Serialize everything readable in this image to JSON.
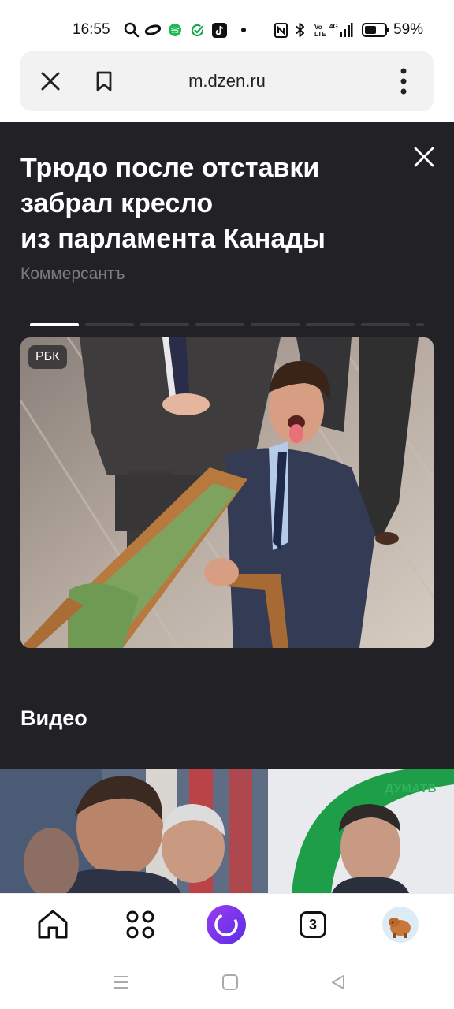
{
  "status_bar": {
    "time": "16:55",
    "battery_percent": "59%",
    "battery_level": 0.59,
    "network_label": "4G",
    "icons": [
      "search-icon",
      "oppo-icon",
      "spotify-icon",
      "check-icon",
      "tiktok-icon",
      "dot-icon",
      "nfc-icon",
      "bluetooth-icon",
      "volte-icon",
      "signal-icon",
      "battery-icon"
    ]
  },
  "browser": {
    "url": "m.dzen.ru",
    "icons": [
      "close-icon",
      "bookmark-icon",
      "more-vertical-icon"
    ]
  },
  "story": {
    "headline": "Трюдо после отставки забрал кресло из парламента Канады",
    "source": "Коммерсантъ",
    "image_badge": "РБК",
    "progress_total": 8,
    "progress_active": 1
  },
  "video_section": {
    "title": "Видео",
    "thumb_label": "ДУМАТВ"
  },
  "bottom_nav": {
    "tabs_count": "3",
    "icons": [
      "home-icon",
      "apps-grid-icon",
      "alice-icon",
      "tabs-icon",
      "profile-avatar"
    ]
  },
  "system_nav": {
    "icons": [
      "menu-icon",
      "home-square-icon",
      "back-icon"
    ]
  },
  "colors": {
    "dark_bg": "#222226",
    "source_gray": "#7c7c82",
    "alice_purple": "#7a35f0",
    "duma_green": "#2fb25a"
  }
}
